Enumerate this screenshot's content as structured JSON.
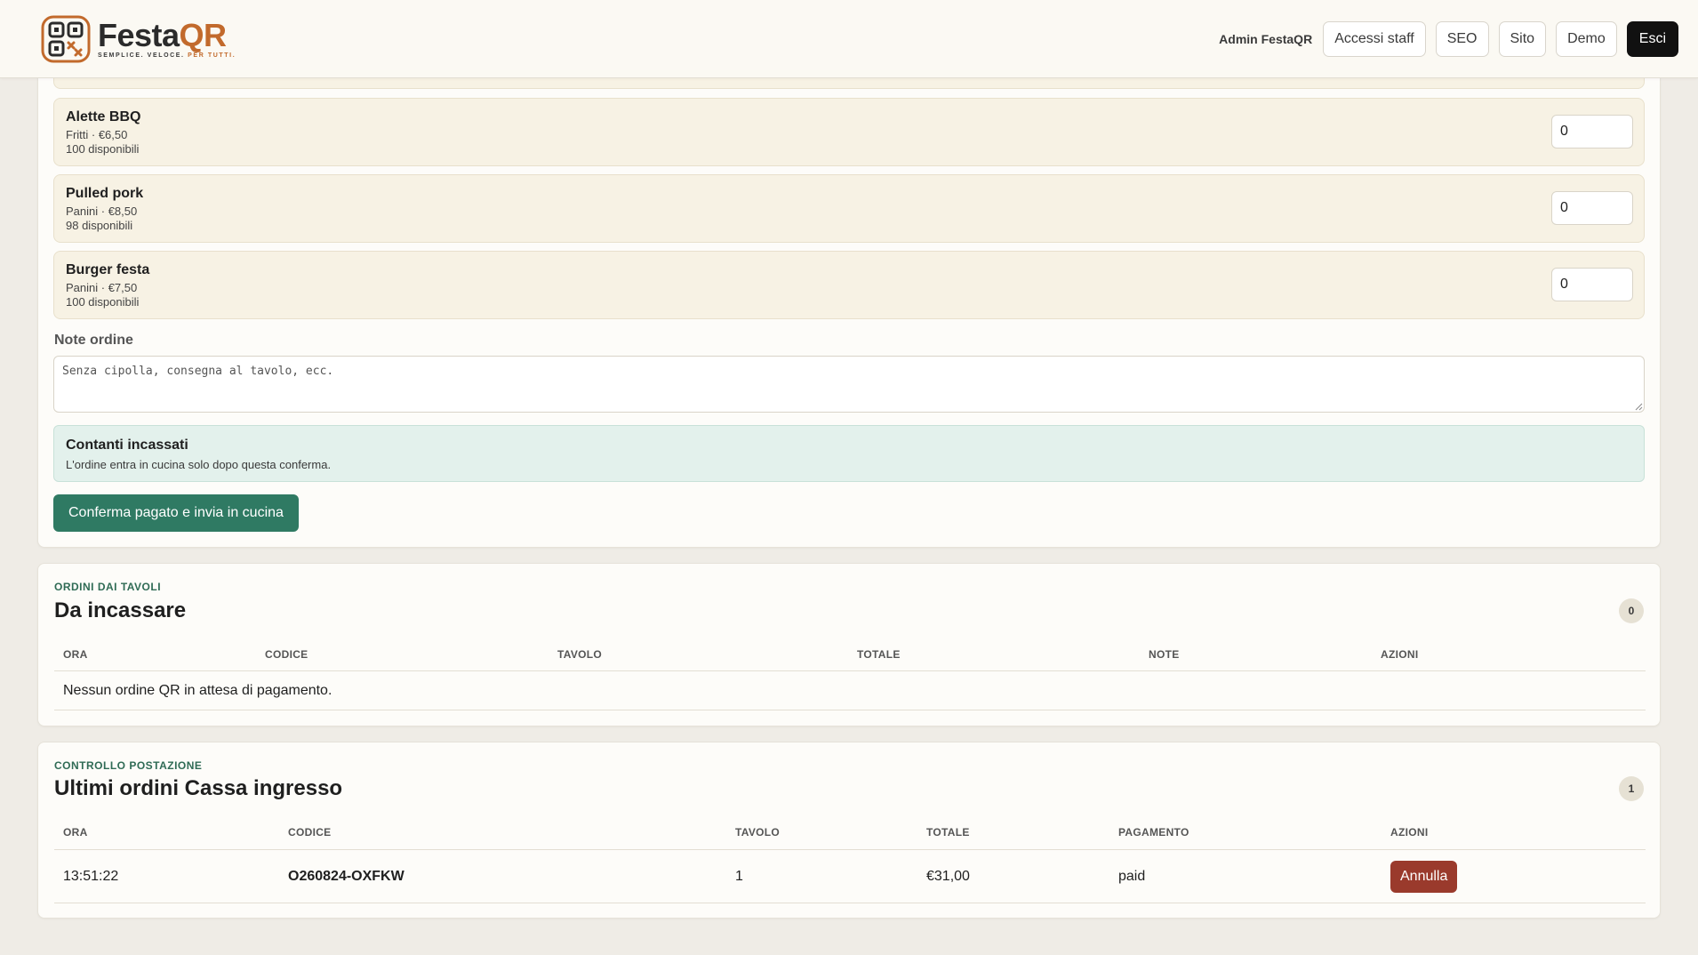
{
  "brand": {
    "name_part1": "Festa",
    "name_part2": "QR",
    "tagline_main": "SEMPLICE. VELOCE.",
    "tagline_accent": "PER TUTTI."
  },
  "header": {
    "admin_label": "Admin FestaQR",
    "nav": [
      "Accessi staff",
      "SEO",
      "Sito",
      "Demo",
      "Esci"
    ]
  },
  "products": [
    {
      "name": "Alette BBQ",
      "category_price": "Fritti · €6,50",
      "availability": "100 disponibili",
      "quantity": "0"
    },
    {
      "name": "Pulled pork",
      "category_price": "Panini · €8,50",
      "availability": "98 disponibili",
      "quantity": "0"
    },
    {
      "name": "Burger festa",
      "category_price": "Panini · €7,50",
      "availability": "100 disponibili",
      "quantity": "0"
    }
  ],
  "order_notes": {
    "label": "Note ordine",
    "placeholder": "Senza cipolla, consegna al tavolo, ecc."
  },
  "cash": {
    "title": "Contanti incassati",
    "subtitle": "L'ordine entra in cucina solo dopo questa conferma."
  },
  "confirm_button": "Conferma pagato e invia in cucina",
  "pending": {
    "eyebrow": "ORDINI DAI TAVOLI",
    "title": "Da incassare",
    "count": "0",
    "columns": [
      "ORA",
      "CODICE",
      "TAVOLO",
      "TOTALE",
      "NOTE",
      "AZIONI"
    ],
    "empty_message": "Nessun ordine QR in attesa di pagamento."
  },
  "recent": {
    "eyebrow": "CONTROLLO POSTAZIONE",
    "title": "Ultimi ordini Cassa ingresso",
    "count": "1",
    "columns": [
      "ORA",
      "CODICE",
      "TAVOLO",
      "TOTALE",
      "PAGAMENTO",
      "AZIONI"
    ],
    "rows": [
      {
        "time": "13:51:22",
        "code": "O260824-OXFKW",
        "table": "1",
        "total": "€31,00",
        "payment": "paid",
        "action": "Annulla"
      }
    ]
  },
  "colors": {
    "accent_green": "#2f7a63",
    "brand_orange": "#c26a2c",
    "danger": "#9a3a2c"
  }
}
